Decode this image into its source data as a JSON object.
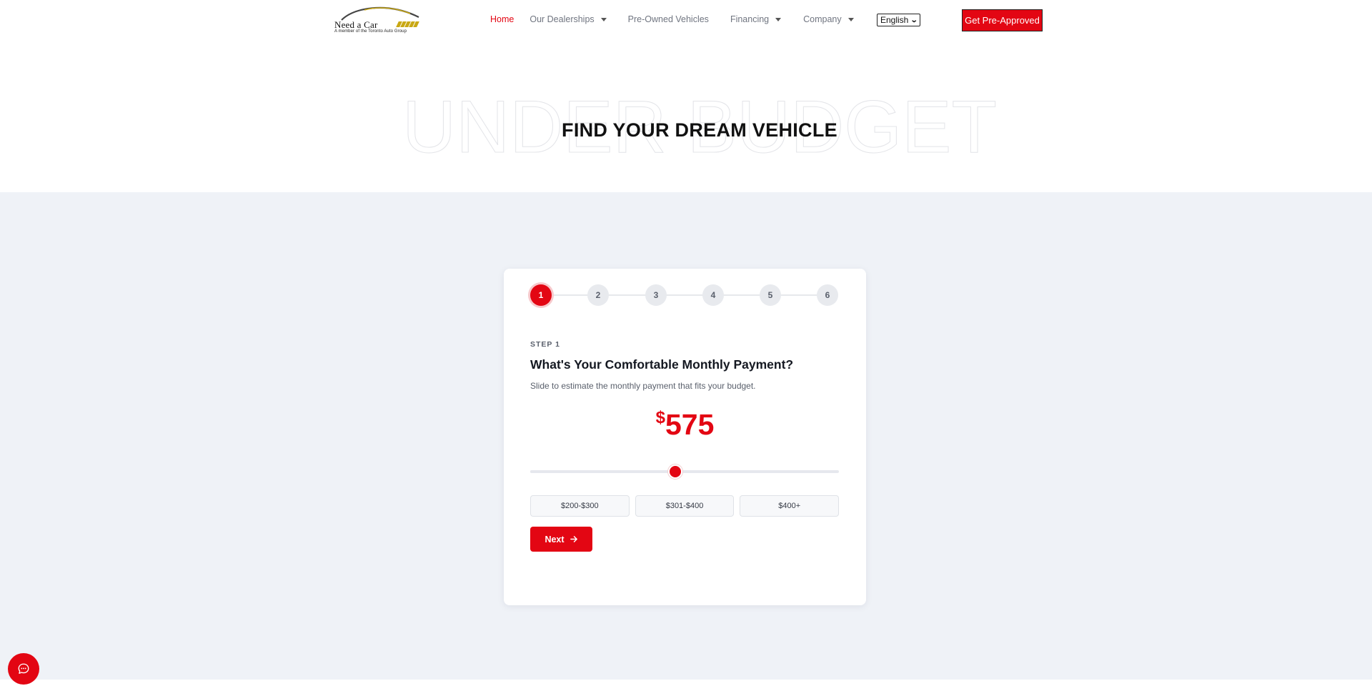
{
  "header": {
    "logo": {
      "name": "Need a Car",
      "tagline": "A member of the Toronto Auto Group"
    },
    "nav": [
      {
        "label": "Home",
        "active": true,
        "dropdown": false
      },
      {
        "label": "Our Dealerships",
        "active": false,
        "dropdown": true
      },
      {
        "label": "Pre-Owned Vehicles",
        "active": false,
        "dropdown": false
      },
      {
        "label": "Financing",
        "active": false,
        "dropdown": true
      },
      {
        "label": "Company",
        "active": false,
        "dropdown": true
      }
    ],
    "language": "English",
    "cta_label": "Get Pre-Approved"
  },
  "hero": {
    "background_text": "UNDER BUDGET",
    "title": "FIND YOUR DREAM VEHICLE"
  },
  "wizard": {
    "steps": [
      "1",
      "2",
      "3",
      "4",
      "5",
      "6"
    ],
    "current_step": 1,
    "step_label": "STEP 1",
    "question": "What's Your Comfortable Monthly Payment?",
    "description": "Slide to estimate the monthly payment that fits your budget.",
    "currency_symbol": "$",
    "amount": "575",
    "slider_fraction": 0.47,
    "presets": [
      "$200-$300",
      "$301-$400",
      "$400+"
    ],
    "next_label": "Next"
  },
  "colors": {
    "accent": "#e30613",
    "section_bg": "#eff2f7",
    "card_bg": "#ffffff",
    "text_dark": "#141821",
    "text_muted": "#5a606c"
  },
  "icons": {
    "next": "arrow-right-icon",
    "chat": "chat-bubble-icon",
    "dropdown": "caret-down-icon"
  }
}
